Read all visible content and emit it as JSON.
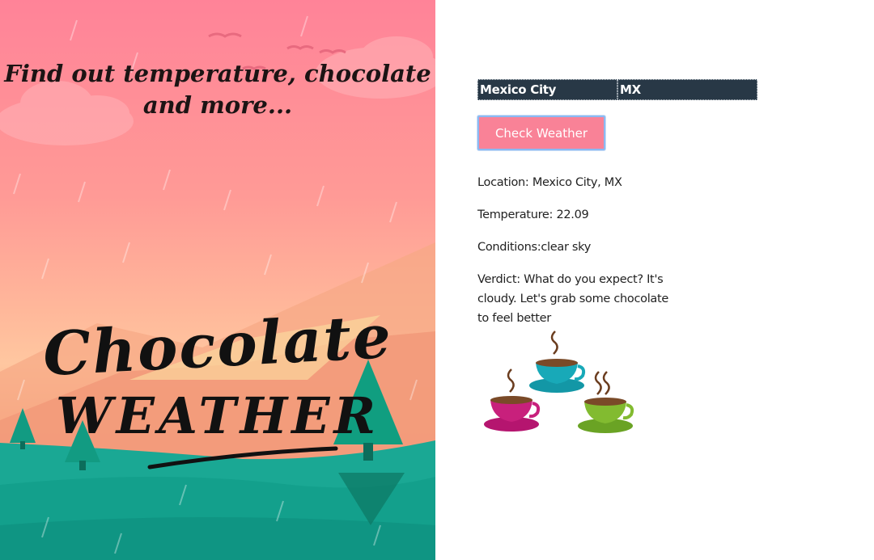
{
  "poster": {
    "tagline": "Find out temperature, chocolate and more...",
    "logo_line_1": "Chocolate",
    "logo_line_2": "WEATHER"
  },
  "form": {
    "city_value": "Mexico City",
    "country_value": "MX",
    "check_button_label": "Check Weather"
  },
  "results": {
    "location": "Location: Mexico City, MX",
    "temperature": "Temperature: 22.09",
    "conditions": "Conditions:clear sky",
    "verdict": "Verdict: What do you expect? It's cloudy. Let's grab some chocolate to feel better"
  },
  "colors": {
    "accent_pink": "#f98297",
    "input_bg": "#283846",
    "teal": "#1aa894"
  },
  "icons": {
    "cups": "coffee-cups-illustration"
  }
}
